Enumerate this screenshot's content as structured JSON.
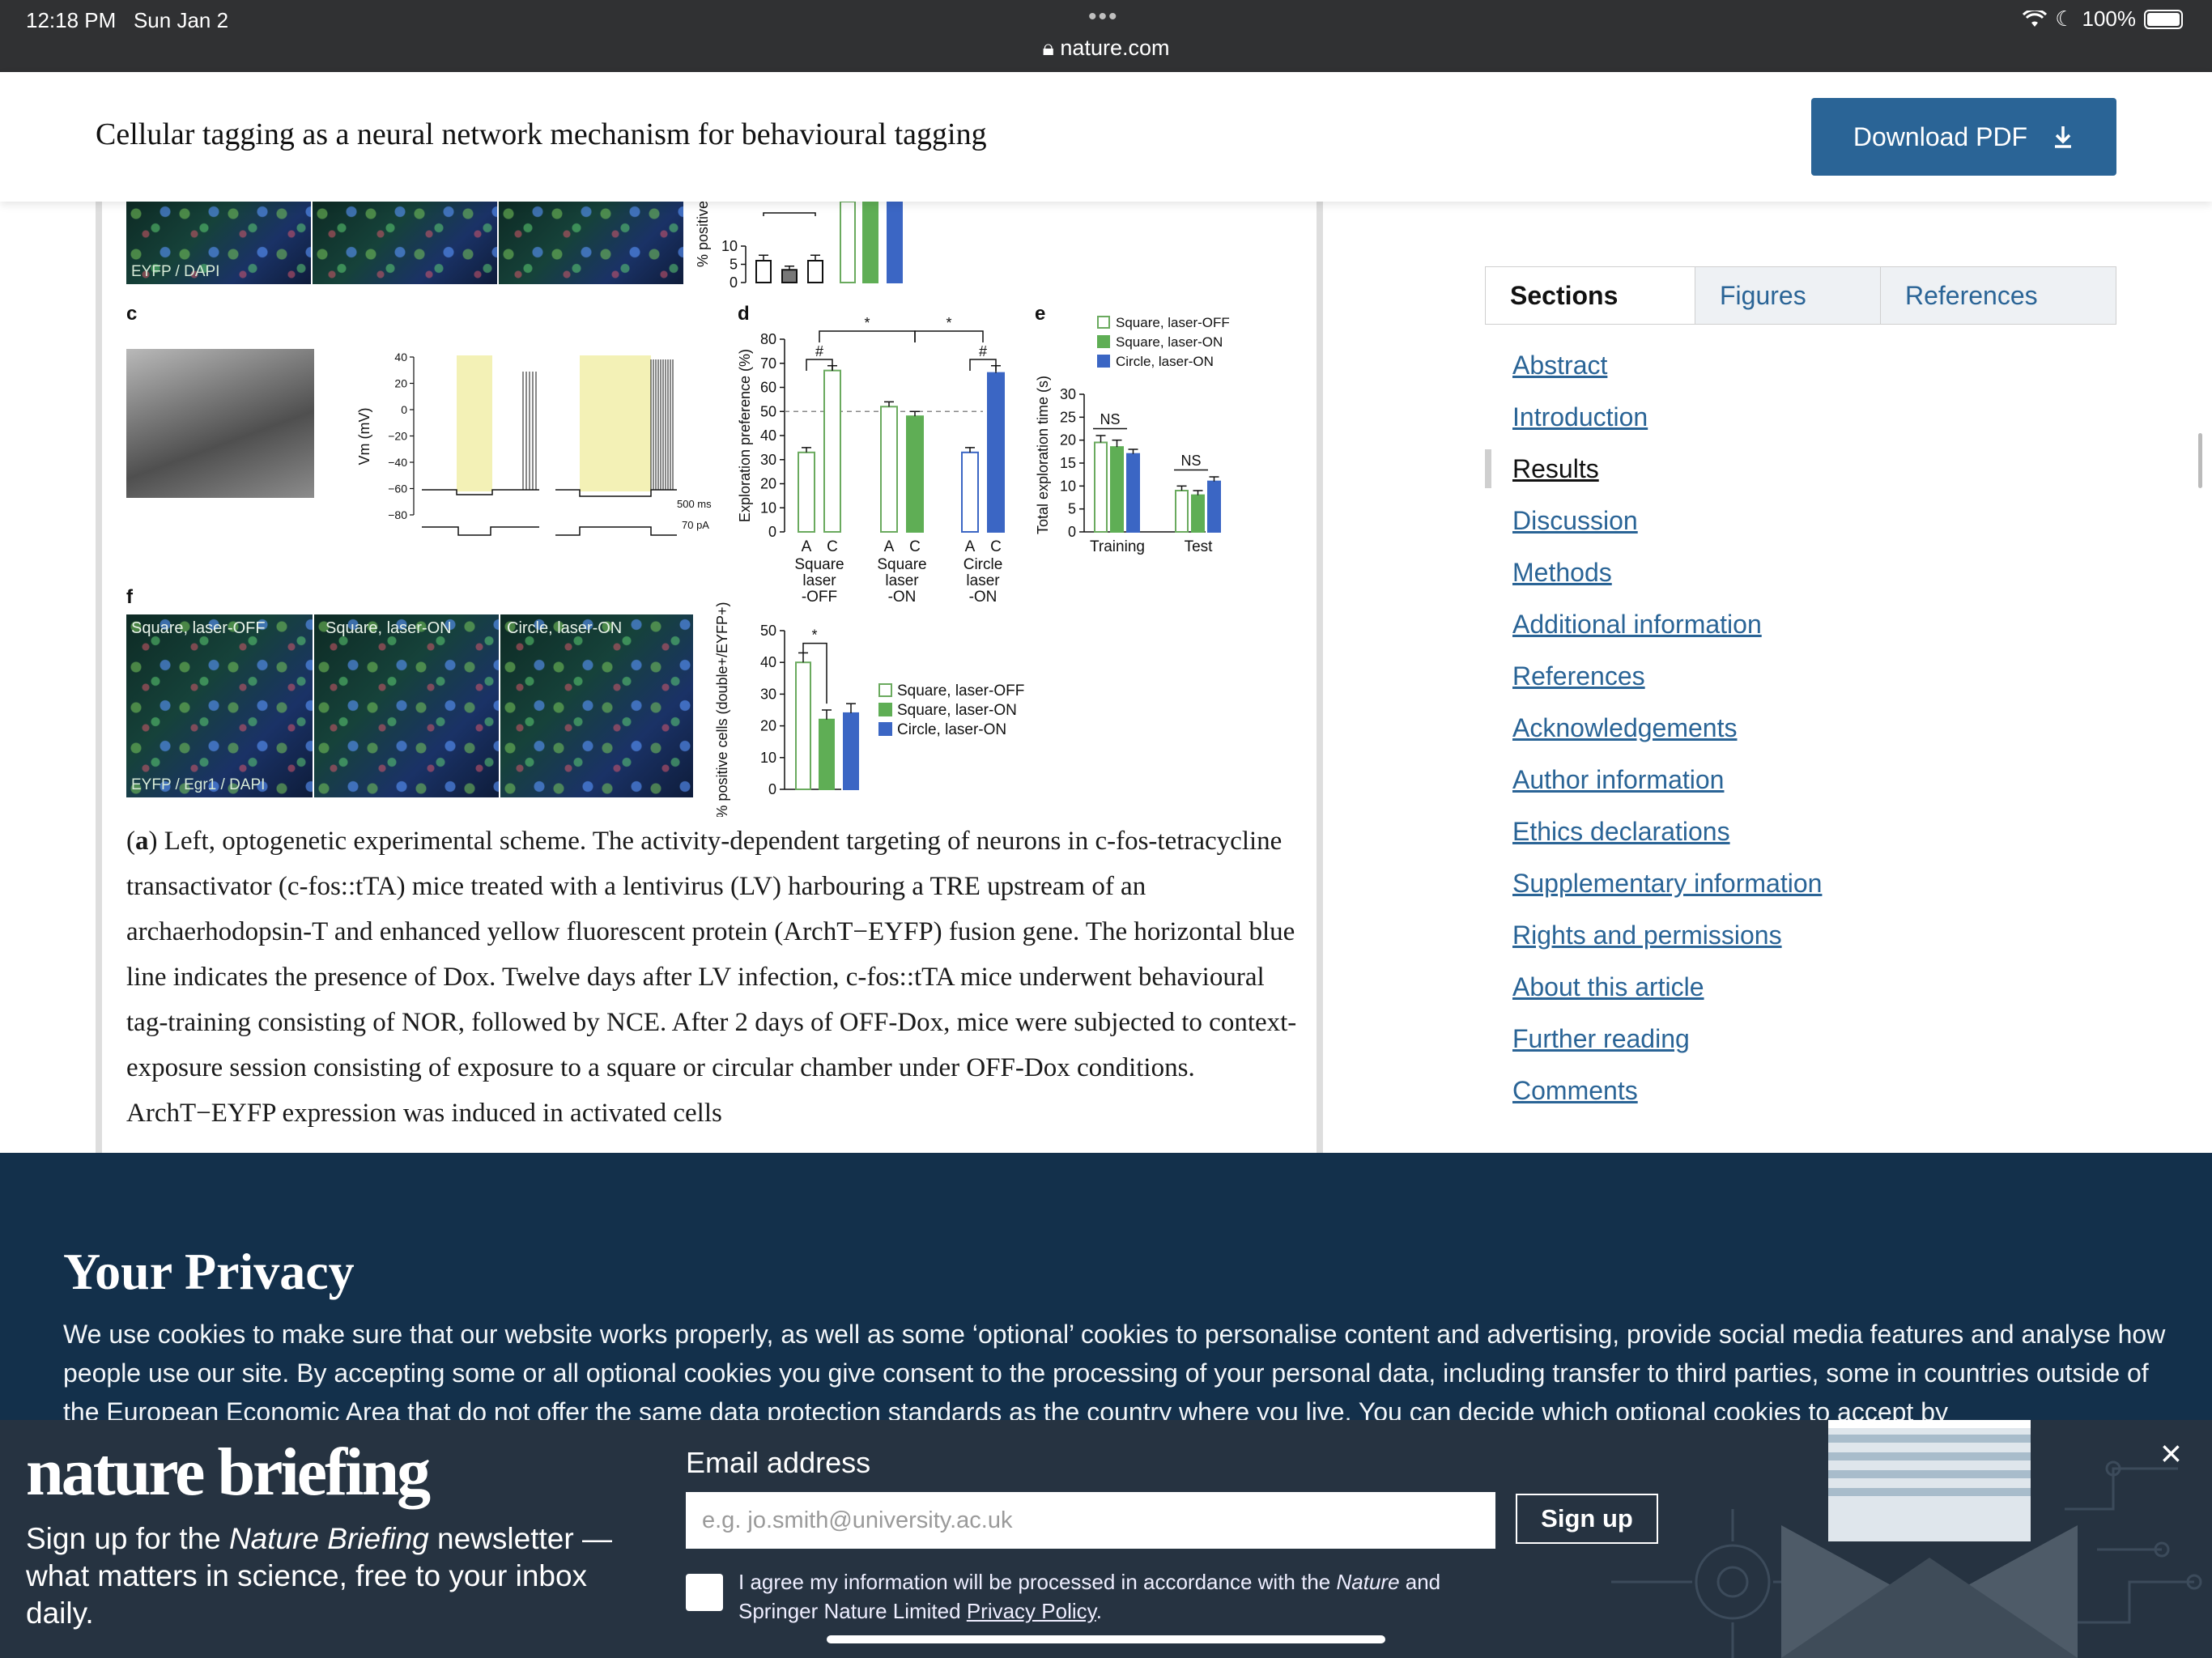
{
  "status_bar": {
    "time": "12:18 PM",
    "date": "Sun Jan 2",
    "url": "nature.com",
    "battery": "100%",
    "dots": "•••"
  },
  "header": {
    "title": "Cellular tagging as a neural network mechanism for behavioural tagging",
    "download_label": "Download PDF"
  },
  "figure": {
    "panel_labels": [
      "c",
      "d",
      "e",
      "f"
    ],
    "top_micro_label": "EYFP / DAPI",
    "top_y_axis": "% positive",
    "top_ticks": [
      "10",
      "5",
      "0"
    ],
    "c_y_axis": "Vm (mV)",
    "c_ticks": [
      "40",
      "20",
      "0",
      "−20",
      "−40",
      "−60",
      "−80"
    ],
    "c_scale_time": "500 ms",
    "c_scale_current": "70 pA",
    "f_micro_labels": [
      "Square, laser-OFF",
      "Square, laser-ON",
      "Circle, laser-ON"
    ],
    "f_micro_bottom": "EYFP / Egr1 / DAPI",
    "legend": [
      "Square, laser-OFF",
      "Square, laser-ON",
      "Circle, laser-ON"
    ],
    "annotations": {
      "hash": "#",
      "star": "*",
      "ns": "NS"
    },
    "colors": {
      "off": "#ffffff",
      "square_on": "#5fae55",
      "circle_on": "#3b66c4",
      "edge_off": "#6aaa5e",
      "edge_circle": "#3b66c4",
      "grey": "#777777",
      "yellow": "#f3f1b6"
    }
  },
  "chart_data": [
    {
      "type": "bar",
      "panel": "d",
      "ylabel": "Exploration preference (%)",
      "ylim": [
        0,
        80
      ],
      "yticks": [
        0,
        10,
        20,
        30,
        40,
        50,
        60,
        70,
        80
      ],
      "reference_line": 50,
      "categories": [
        "A",
        "C",
        "A",
        "C",
        "A",
        "C"
      ],
      "groups": [
        "Square laser -OFF",
        "Square laser -ON",
        "Circle laser -ON"
      ],
      "values": [
        33,
        67,
        52,
        48,
        33,
        66
      ],
      "errors": [
        2,
        2,
        2,
        2,
        2,
        3
      ],
      "fills": [
        "off",
        "off",
        "off",
        "square_on",
        "off",
        "circle_on"
      ],
      "edges": [
        "edge_off",
        "edge_off",
        "edge_off",
        "square_on",
        "edge_circle",
        "circle_on"
      ]
    },
    {
      "type": "bar",
      "panel": "e",
      "ylabel": "Total exploration time (s)",
      "ylim": [
        0,
        30
      ],
      "yticks": [
        0,
        5,
        10,
        15,
        20,
        25,
        30
      ],
      "categories": [
        "Training",
        "Test"
      ],
      "series": [
        {
          "name": "Square, laser-OFF",
          "values": [
            19.5,
            9
          ],
          "errors": [
            1.5,
            1
          ]
        },
        {
          "name": "Square, laser-ON",
          "values": [
            18.5,
            8
          ],
          "errors": [
            1.5,
            1
          ]
        },
        {
          "name": "Circle, laser-ON",
          "values": [
            17,
            11
          ],
          "errors": [
            1,
            1
          ]
        }
      ]
    },
    {
      "type": "bar",
      "panel": "f",
      "ylabel": "% positive cells (double+/EYFP+)",
      "ylim": [
        0,
        50
      ],
      "yticks": [
        0,
        10,
        20,
        30,
        40,
        50
      ],
      "categories": [
        "Square, laser-OFF",
        "Square, laser-ON",
        "Circle, laser-ON"
      ],
      "values": [
        40,
        22,
        24
      ],
      "errors": [
        3,
        3,
        3
      ]
    },
    {
      "type": "bar",
      "panel": "top",
      "ylabel": "% positive",
      "ylim": [
        0,
        10
      ],
      "values": [
        6,
        3.5,
        6
      ],
      "errors": [
        1.5,
        1,
        1.5
      ]
    }
  ],
  "caption": {
    "lead": "a",
    "text": ") Left, optogenetic experimental scheme. The activity-dependent targeting of neurons in c-fos-tetracycline transactivator (c-fos::tTA) mice treated with a lentivirus (LV) harbouring a TRE upstream of an archaerhodopsin-T and enhanced yellow fluorescent protein (ArchT−EYFP) fusion gene. The horizontal blue line indicates the presence of Dox. Twelve days after LV infection, c-fos::tTA mice underwent behavioural tag-training consisting of NOR, followed by NCE. After 2 days of OFF-Dox, mice were subjected to context-exposure session consisting of exposure to a square or circular chamber under OFF-Dox conditions. ArchT−EYFP expression was induced in activated cells"
  },
  "sidebar": {
    "tabs": [
      "Sections",
      "Figures",
      "References"
    ],
    "items": [
      "Abstract",
      "Introduction",
      "Results",
      "Discussion",
      "Methods",
      "Additional information",
      "References",
      "Acknowledgements",
      "Author information",
      "Ethics declarations",
      "Supplementary information",
      "Rights and permissions",
      "About this article",
      "Further reading",
      "Comments"
    ],
    "current": "Results"
  },
  "privacy": {
    "title": "Your Privacy",
    "text": "We use cookies to make sure that our website works properly, as well as some ‘optional’ cookies to personalise content and advertising, provide social media features and analyse how people use our site. By accepting some or all optional cookies you give consent to the processing of your personal data, including transfer to third parties, some in countries outside of the European Economic Area that do not offer the same data protection standards as the country where you live. You can decide which optional cookies to accept by"
  },
  "briefing": {
    "logo": "nature briefing",
    "desc_pre": "Sign up for the ",
    "desc_italic": "Nature Briefing",
    "desc_post": " newsletter — what matters in science, free to your inbox daily.",
    "email_label": "Email address",
    "email_placeholder": "e.g. jo.smith@university.ac.uk",
    "signup_label": "Sign up",
    "consent_pre": "I agree my information will be processed in accordance with the ",
    "consent_italic": "Nature",
    "consent_mid": " and Springer Nature Limited ",
    "consent_link": "Privacy Policy",
    "consent_post": ".",
    "close": "×"
  }
}
